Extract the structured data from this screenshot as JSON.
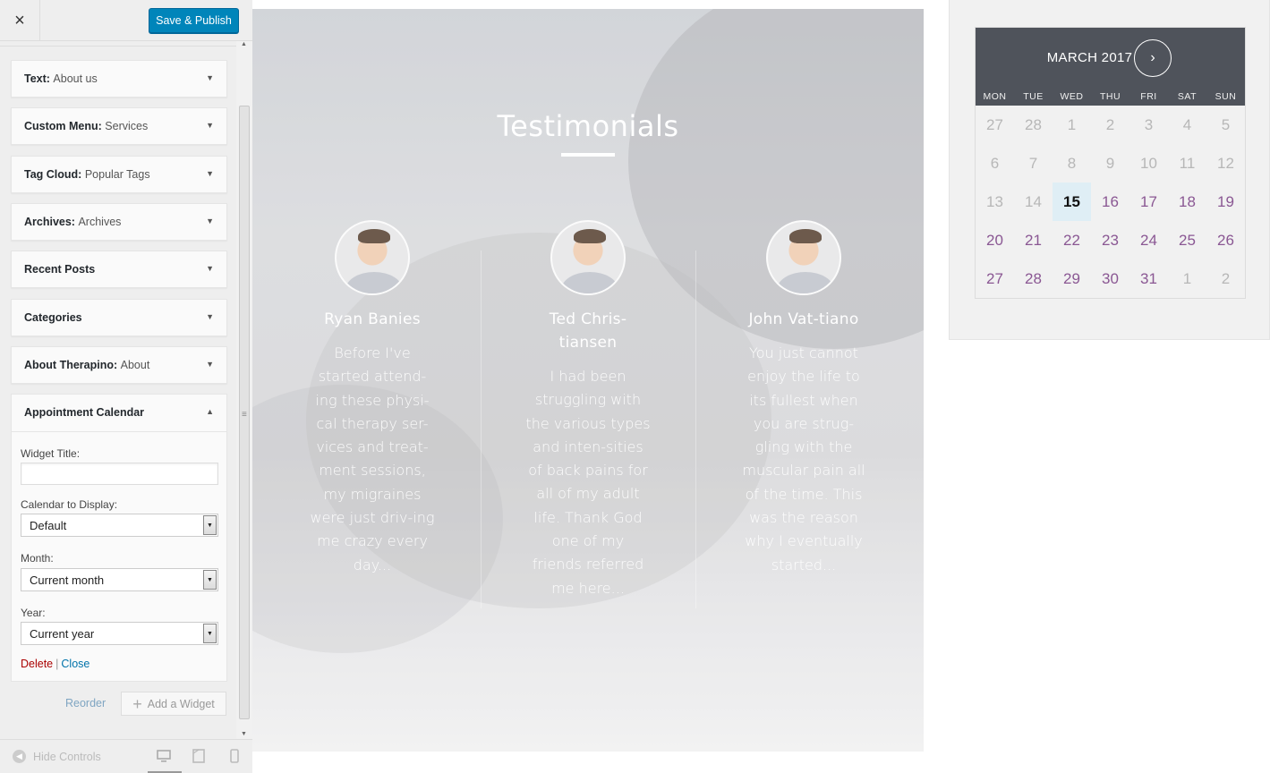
{
  "customizer": {
    "close_label": "×",
    "save_label": "Save & Publish",
    "widgets": [
      {
        "title": "Text:",
        "sub": "About us"
      },
      {
        "title": "Custom Menu:",
        "sub": "Services"
      },
      {
        "title": "Tag Cloud:",
        "sub": "Popular Tags"
      },
      {
        "title": "Archives:",
        "sub": "Archives"
      },
      {
        "title": "Recent Posts",
        "sub": ""
      },
      {
        "title": "Categories",
        "sub": ""
      },
      {
        "title": "About Therapino:",
        "sub": "About"
      }
    ],
    "appointment": {
      "title": "Appointment Calendar",
      "widget_title_label": "Widget Title:",
      "widget_title_value": "",
      "calendar_label": "Calendar to Display:",
      "calendar_value": "Default",
      "month_label": "Month:",
      "month_value": "Current month",
      "year_label": "Year:",
      "year_value": "Current year",
      "delete_label": "Delete",
      "separator": "|",
      "close_label": "Close"
    },
    "reorder_label": "Reorder",
    "add_widget_label": "Add a Widget",
    "hide_controls_label": "Hide Controls"
  },
  "testimonials": {
    "title": "Testimonials",
    "items": [
      {
        "name": "Ryan Banies",
        "quote": "Before I've started attend-ing these physi-cal therapy ser-vices and treat-ment sessions, my migraines were just driv-ing me crazy every day..."
      },
      {
        "name": "Ted Chris-tiansen",
        "quote": "I had been struggling with the various types and inten-sities of back pains for all of my adult life. Thank God one of my friends referred me here..."
      },
      {
        "name": "John Vat-tiano",
        "quote": "You just cannot enjoy the life to its fullest when you are strug-gling with the muscular pain all of the time. This was the reason why I eventually started..."
      }
    ]
  },
  "calendar": {
    "month_label": "MARCH 2017",
    "next_icon": "›",
    "weekdays": [
      "MON",
      "TUE",
      "WED",
      "THU",
      "FRI",
      "SAT",
      "SUN"
    ],
    "weeks": [
      [
        {
          "d": "27",
          "s": "muted"
        },
        {
          "d": "28",
          "s": "muted"
        },
        {
          "d": "1",
          "s": "muted"
        },
        {
          "d": "2",
          "s": "muted"
        },
        {
          "d": "3",
          "s": "muted"
        },
        {
          "d": "4",
          "s": "muted"
        },
        {
          "d": "5",
          "s": "muted"
        }
      ],
      [
        {
          "d": "6",
          "s": "muted"
        },
        {
          "d": "7",
          "s": "muted"
        },
        {
          "d": "8",
          "s": "muted"
        },
        {
          "d": "9",
          "s": "muted"
        },
        {
          "d": "10",
          "s": "muted"
        },
        {
          "d": "11",
          "s": "muted"
        },
        {
          "d": "12",
          "s": "muted"
        }
      ],
      [
        {
          "d": "13",
          "s": "muted"
        },
        {
          "d": "14",
          "s": "muted"
        },
        {
          "d": "15",
          "s": "today"
        },
        {
          "d": "16",
          "s": "avail"
        },
        {
          "d": "17",
          "s": "avail"
        },
        {
          "d": "18",
          "s": "avail"
        },
        {
          "d": "19",
          "s": "avail"
        }
      ],
      [
        {
          "d": "20",
          "s": "avail"
        },
        {
          "d": "21",
          "s": "avail"
        },
        {
          "d": "22",
          "s": "avail"
        },
        {
          "d": "23",
          "s": "avail"
        },
        {
          "d": "24",
          "s": "avail"
        },
        {
          "d": "25",
          "s": "avail"
        },
        {
          "d": "26",
          "s": "avail"
        }
      ],
      [
        {
          "d": "27",
          "s": "avail"
        },
        {
          "d": "28",
          "s": "avail"
        },
        {
          "d": "29",
          "s": "avail"
        },
        {
          "d": "30",
          "s": "avail"
        },
        {
          "d": "31",
          "s": "avail"
        },
        {
          "d": "1",
          "s": "muted"
        },
        {
          "d": "2",
          "s": "muted"
        }
      ]
    ]
  },
  "colors": {
    "primary_button": "#0085ba",
    "delete_link": "#aa0000",
    "close_link": "#0073aa",
    "calendar_header": "#4f535b",
    "calendar_available": "#8a5793",
    "calendar_today_bg": "#dfeef5"
  }
}
